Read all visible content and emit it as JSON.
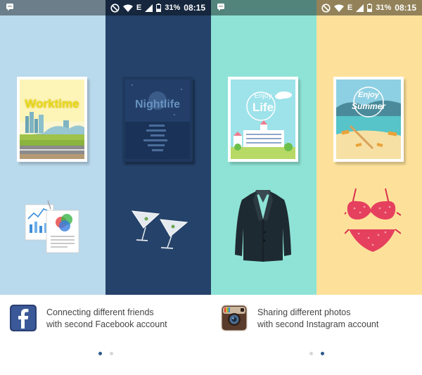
{
  "status_bar": {
    "battery": "31%",
    "time": "08:15",
    "network": "E",
    "icons": [
      "notification-icon",
      "do-not-disturb-icon",
      "wifi-icon",
      "signal-icon",
      "battery-icon"
    ]
  },
  "screens": [
    {
      "panels": [
        {
          "label": "Worktime",
          "bg": "#b9d9ec",
          "label_color": "#e9d81f",
          "item": "paper-charts-icon"
        },
        {
          "label": "Nightlife",
          "bg": "#25426a",
          "label_color": "#5d89b7",
          "item": "martini-glasses-icon"
        }
      ],
      "app": "facebook",
      "description": [
        "Connecting different friends",
        "with second Facebook account"
      ],
      "pager": {
        "count": 2,
        "active": 0
      }
    },
    {
      "panels": [
        {
          "label": "Enjoy Life",
          "bg": "#8ee3d6",
          "label_color": "#ffffff",
          "item": "blazer-icon"
        },
        {
          "label": "Enjoy Summer",
          "bg": "#fde19a",
          "label_color": "#ffffff",
          "item": "bikini-icon"
        }
      ],
      "app": "instagram",
      "description": [
        "Sharing different photos",
        "with second Instagram account"
      ],
      "pager": {
        "count": 2,
        "active": 1
      }
    }
  ],
  "colors": {
    "facebook_blue": "#3b5998",
    "dot_active": "#2e5a8c",
    "dot_inactive": "#d6d6d6",
    "text": "#444444"
  }
}
